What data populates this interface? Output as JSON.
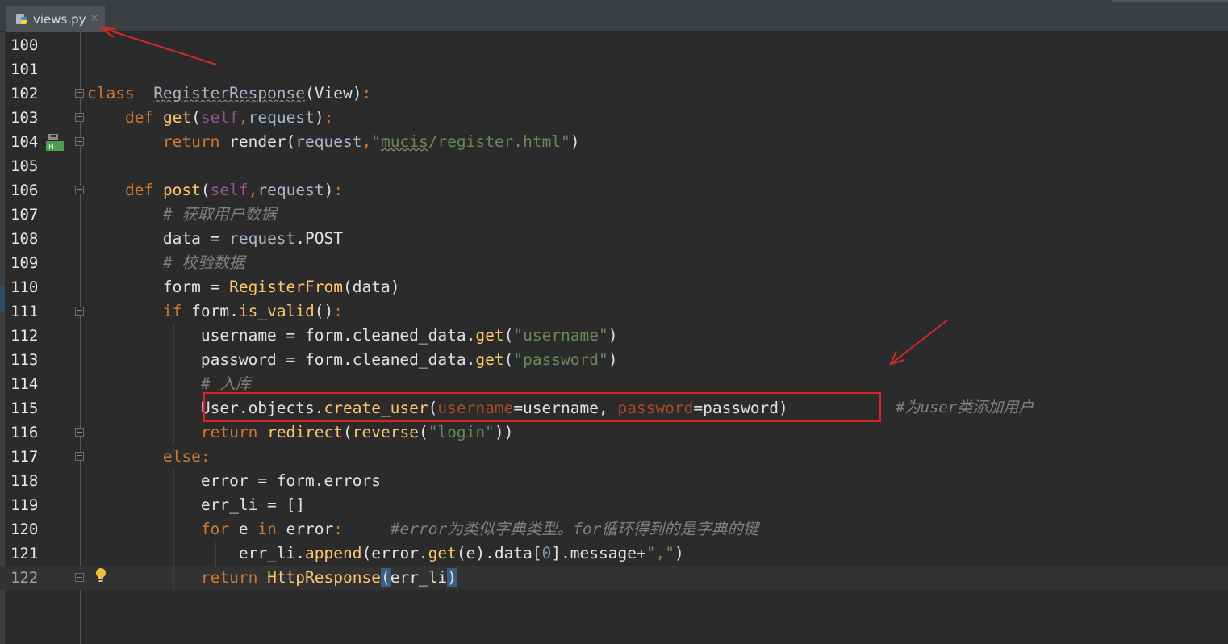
{
  "tab": {
    "title": "views.py",
    "close": "×",
    "icon": "python-file-icon"
  },
  "editor": {
    "lines": [
      {
        "n": "100",
        "tokens": []
      },
      {
        "n": "101",
        "tokens": []
      },
      {
        "n": "102",
        "tokens": [
          {
            "t": "class",
            "c": "kw"
          },
          {
            "t": "  ",
            "c": "df"
          },
          {
            "t": "RegisterResponse",
            "c": "cl"
          },
          {
            "t": "(View)",
            "c": "df"
          },
          {
            "t": ":",
            "c": "kw"
          }
        ]
      },
      {
        "n": "103",
        "tokens": [
          {
            "t": "    ",
            "c": "df"
          },
          {
            "t": "def ",
            "c": "kw"
          },
          {
            "t": "get",
            "c": "fn"
          },
          {
            "t": "(",
            "c": "df"
          },
          {
            "t": "self",
            "c": "sf"
          },
          {
            "t": ",",
            "c": "kw"
          },
          {
            "t": "request",
            "c": "pm"
          },
          {
            "t": ")",
            "c": "df"
          },
          {
            "t": ":",
            "c": "kw"
          }
        ]
      },
      {
        "n": "104",
        "tokens": [
          {
            "t": "        ",
            "c": "df"
          },
          {
            "t": "return ",
            "c": "kw"
          },
          {
            "t": "render(",
            "c": "df"
          },
          {
            "t": "request",
            "c": "pm"
          },
          {
            "t": ",",
            "c": "kw"
          },
          {
            "t": "\"mucis/register.html\"",
            "c": "st"
          },
          {
            "t": ")",
            "c": "df"
          }
        ]
      },
      {
        "n": "105",
        "tokens": []
      },
      {
        "n": "106",
        "tokens": [
          {
            "t": "    ",
            "c": "df"
          },
          {
            "t": "def ",
            "c": "kw"
          },
          {
            "t": "post",
            "c": "fn"
          },
          {
            "t": "(",
            "c": "df"
          },
          {
            "t": "self",
            "c": "sf"
          },
          {
            "t": ",",
            "c": "kw"
          },
          {
            "t": "request",
            "c": "pm"
          },
          {
            "t": ")",
            "c": "df"
          },
          {
            "t": ":",
            "c": "kw"
          }
        ]
      },
      {
        "n": "107",
        "tokens": [
          {
            "t": "        ",
            "c": "df"
          },
          {
            "t": "# 获取用户数据",
            "c": "cm"
          }
        ]
      },
      {
        "n": "108",
        "tokens": [
          {
            "t": "        data = ",
            "c": "df"
          },
          {
            "t": "request",
            "c": "pm"
          },
          {
            "t": ".POST",
            "c": "df"
          }
        ]
      },
      {
        "n": "109",
        "tokens": [
          {
            "t": "        ",
            "c": "df"
          },
          {
            "t": "# 校验数据",
            "c": "cm"
          }
        ]
      },
      {
        "n": "110",
        "tokens": [
          {
            "t": "        form = ",
            "c": "df"
          },
          {
            "t": "RegisterFrom",
            "c": "fn"
          },
          {
            "t": "(data)",
            "c": "df"
          }
        ]
      },
      {
        "n": "111",
        "tokens": [
          {
            "t": "        ",
            "c": "df"
          },
          {
            "t": "if ",
            "c": "kw"
          },
          {
            "t": "form.",
            "c": "df"
          },
          {
            "t": "is_valid",
            "c": "fn"
          },
          {
            "t": "()",
            "c": "df"
          },
          {
            "t": ":",
            "c": "kw"
          }
        ]
      },
      {
        "n": "112",
        "tokens": [
          {
            "t": "            username = form.",
            "c": "df"
          },
          {
            "t": "cleaned_data",
            "c": "df"
          },
          {
            "t": ".",
            "c": "df"
          },
          {
            "t": "get",
            "c": "fn"
          },
          {
            "t": "(",
            "c": "df"
          },
          {
            "t": "\"username\"",
            "c": "st"
          },
          {
            "t": ")",
            "c": "df"
          }
        ]
      },
      {
        "n": "113",
        "tokens": [
          {
            "t": "            password = form.",
            "c": "df"
          },
          {
            "t": "cleaned_data",
            "c": "df"
          },
          {
            "t": ".",
            "c": "df"
          },
          {
            "t": "get",
            "c": "fn"
          },
          {
            "t": "(",
            "c": "df"
          },
          {
            "t": "\"password\"",
            "c": "st"
          },
          {
            "t": ")",
            "c": "df"
          }
        ]
      },
      {
        "n": "114",
        "tokens": [
          {
            "t": "            ",
            "c": "df"
          },
          {
            "t": "# 入库",
            "c": "cm"
          }
        ]
      },
      {
        "n": "115",
        "tokens": [
          {
            "t": "            User.objects.",
            "c": "df"
          },
          {
            "t": "create_user",
            "c": "fn"
          },
          {
            "t": "(",
            "c": "df"
          },
          {
            "t": "username",
            "c": "vp"
          },
          {
            "t": "=username, ",
            "c": "df"
          },
          {
            "t": "password",
            "c": "vp"
          },
          {
            "t": "=password)",
            "c": "df"
          }
        ]
      },
      {
        "n": "116",
        "tokens": [
          {
            "t": "            ",
            "c": "df"
          },
          {
            "t": "return ",
            "c": "kw"
          },
          {
            "t": "redirect",
            "c": "fn"
          },
          {
            "t": "(",
            "c": "df"
          },
          {
            "t": "reverse",
            "c": "fn"
          },
          {
            "t": "(",
            "c": "df"
          },
          {
            "t": "\"login\"",
            "c": "st"
          },
          {
            "t": "))",
            "c": "df"
          }
        ]
      },
      {
        "n": "117",
        "tokens": [
          {
            "t": "        ",
            "c": "df"
          },
          {
            "t": "else",
            "c": "kw"
          },
          {
            "t": ":",
            "c": "kw"
          }
        ]
      },
      {
        "n": "118",
        "tokens": [
          {
            "t": "            error = form.errors",
            "c": "df"
          }
        ]
      },
      {
        "n": "119",
        "tokens": [
          {
            "t": "            err_li = []",
            "c": "df"
          }
        ]
      },
      {
        "n": "120",
        "tokens": [
          {
            "t": "            ",
            "c": "df"
          },
          {
            "t": "for ",
            "c": "kw"
          },
          {
            "t": "e ",
            "c": "df"
          },
          {
            "t": "in ",
            "c": "kw"
          },
          {
            "t": "error",
            "c": "df"
          },
          {
            "t": ":",
            "c": "kw"
          },
          {
            "t": "     ",
            "c": "df"
          },
          {
            "t": "#error为类似字典类型。for循环得到的是字典的键",
            "c": "cm"
          }
        ]
      },
      {
        "n": "121",
        "tokens": [
          {
            "t": "                err_li.",
            "c": "df"
          },
          {
            "t": "append",
            "c": "fn"
          },
          {
            "t": "(error.",
            "c": "df"
          },
          {
            "t": "get",
            "c": "fn"
          },
          {
            "t": "(e).data[",
            "c": "df"
          },
          {
            "t": "0",
            "c": "nm"
          },
          {
            "t": "].message+",
            "c": "df"
          },
          {
            "t": "\",\"",
            "c": "st"
          },
          {
            "t": ")",
            "c": "df"
          }
        ]
      },
      {
        "n": "122",
        "tokens": [
          {
            "t": "            ",
            "c": "df"
          },
          {
            "t": "return ",
            "c": "kw"
          },
          {
            "t": "HttpResponse",
            "c": "fn"
          },
          {
            "t": "(",
            "c": "df br"
          },
          {
            "t": "err_li",
            "c": "df"
          },
          {
            "t": ")",
            "c": "df br"
          }
        ]
      }
    ],
    "trailing_comment": "#为user类添加用户"
  }
}
